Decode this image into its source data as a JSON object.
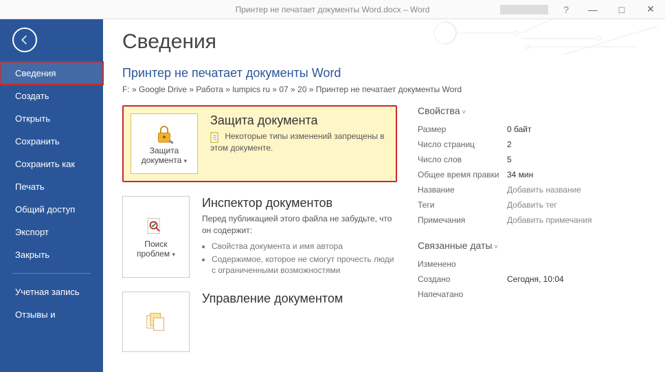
{
  "titlebar": {
    "title": "Принтер не печатает документы Word.docx  –  Word",
    "help": "?",
    "min": "—",
    "max": "□",
    "close": "✕"
  },
  "sidebar": {
    "back": "←",
    "items": [
      "Сведения",
      "Создать",
      "Открыть",
      "Сохранить",
      "Сохранить как",
      "Печать",
      "Общий доступ",
      "Экспорт",
      "Закрыть"
    ],
    "footer": [
      "Учетная запись",
      "Отзывы и"
    ]
  },
  "page": {
    "title": "Сведения",
    "doc_title": "Принтер не печатает документы Word",
    "breadcrumb": "F: » Google Drive » Работа » lumpics ru » 07 » 20 » Принтер не печатает документы Word"
  },
  "protect": {
    "btn_line1": "Защита",
    "btn_line2": "документа",
    "title": "Защита документа",
    "desc": "Некоторые типы изменений запрещены в этом документе."
  },
  "inspect": {
    "btn_line1": "Поиск",
    "btn_line2": "проблем",
    "title": "Инспектор документов",
    "desc": "Перед публикацией этого файла не забудьте, что он содержит:",
    "bullets": [
      "Свойства документа и имя автора",
      "Содержимое, которое не смогут прочесть люди с ограниченными возможностями"
    ]
  },
  "manage": {
    "title": "Управление документом"
  },
  "props": {
    "heading": "Свойства",
    "rows": [
      {
        "label": "Размер",
        "value": "0 байт"
      },
      {
        "label": "Число страниц",
        "value": "2"
      },
      {
        "label": "Число слов",
        "value": "5"
      },
      {
        "label": "Общее время правки",
        "value": "34 мин"
      },
      {
        "label": "Название",
        "value": "Добавить название",
        "link": true
      },
      {
        "label": "Теги",
        "value": "Добавить тег",
        "link": true
      },
      {
        "label": "Примечания",
        "value": "Добавить примечания",
        "link": true
      }
    ]
  },
  "dates": {
    "heading": "Связанные даты",
    "rows": [
      {
        "label": "Изменено",
        "value": ""
      },
      {
        "label": "Создано",
        "value": "Сегодня, 10:04"
      },
      {
        "label": "Напечатано",
        "value": ""
      }
    ]
  }
}
